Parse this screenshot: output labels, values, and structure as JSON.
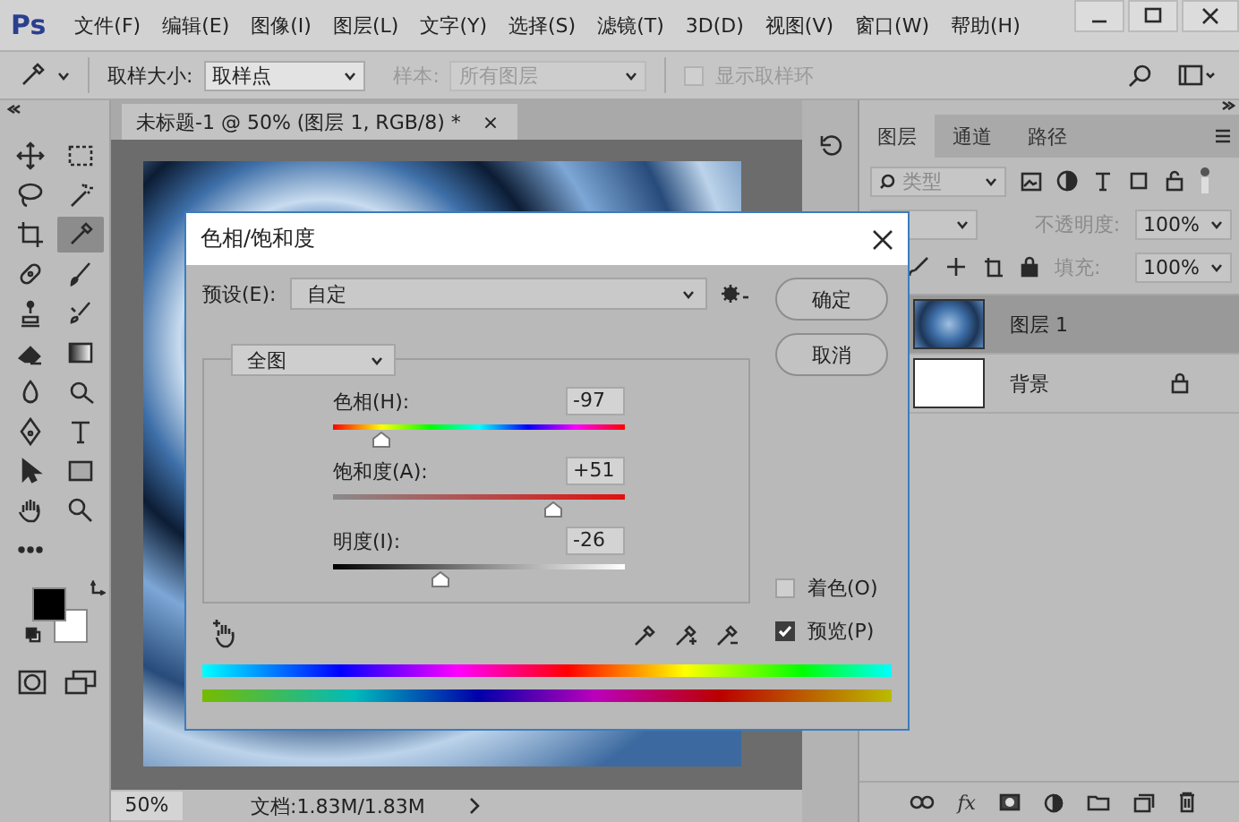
{
  "menu_bar": {
    "logo": "Ps",
    "items": [
      "文件(F)",
      "编辑(E)",
      "图像(I)",
      "图层(L)",
      "文字(Y)",
      "选择(S)",
      "滤镜(T)",
      "3D(D)",
      "视图(V)",
      "窗口(W)",
      "帮助(H)"
    ]
  },
  "options_bar": {
    "sample_size_label": "取样大小:",
    "sample_size_value": "取样点",
    "sample_label": "样本:",
    "sample_value": "所有图层",
    "sample_disabled": true,
    "sample_ring": {
      "label": "显示取样环",
      "checked": false,
      "disabled": true
    }
  },
  "tools": [
    {
      "selected": false
    },
    {
      "selected": false
    },
    {
      "selected": false
    },
    {
      "selected": false
    },
    {
      "selected": false
    },
    {
      "selected": true
    },
    {
      "selected": false
    },
    {
      "selected": false
    },
    {
      "selected": false
    },
    {
      "selected": false
    },
    {
      "selected": false
    },
    {
      "selected": false
    },
    {
      "selected": false
    },
    {
      "selected": false
    },
    {
      "selected": false
    },
    {
      "selected": false
    },
    {
      "selected": false
    },
    {
      "selected": false
    },
    {
      "selected": false
    },
    {
      "selected": false
    },
    {
      "selected": false
    }
  ],
  "document": {
    "tab_title": "未标题-1 @ 50% (图层 1, RGB/8) *",
    "close": "×",
    "zoom": "50%",
    "doc_info": "文档:1.83M/1.83M"
  },
  "layers_panel": {
    "tabs": [
      {
        "label": "图层",
        "selected": true
      },
      {
        "label": "通道",
        "selected": false
      },
      {
        "label": "路径",
        "selected": false
      }
    ],
    "filter_kind": "类型",
    "opacity_label": "不透明度:",
    "opacity_value": "100%",
    "fill_label": "填充:",
    "fill_value": "100%",
    "layers": [
      {
        "name": "图层 1",
        "selected": true,
        "locked": false,
        "kind": "texture"
      },
      {
        "name": "背景",
        "selected": false,
        "locked": true,
        "kind": "white"
      }
    ],
    "fx": "fx"
  },
  "dialog": {
    "title": "色相/饱和度",
    "preset_label": "预设(E):",
    "preset_value": "自定",
    "channel": "全图",
    "buttons": [
      "确定",
      "取消"
    ],
    "sliders": [
      {
        "kind": "hue",
        "label": "色相(H):",
        "value": "-97",
        "level": 0.165
      },
      {
        "kind": "saturation",
        "label": "饱和度(A):",
        "value": "+51",
        "level": 0.755
      },
      {
        "kind": "lightness",
        "label": "明度(I):",
        "value": "-26",
        "level": 0.37
      }
    ],
    "checkboxes": [
      {
        "label": "着色(O)",
        "checked": false
      },
      {
        "label": "预览(P)",
        "checked": true
      }
    ]
  }
}
